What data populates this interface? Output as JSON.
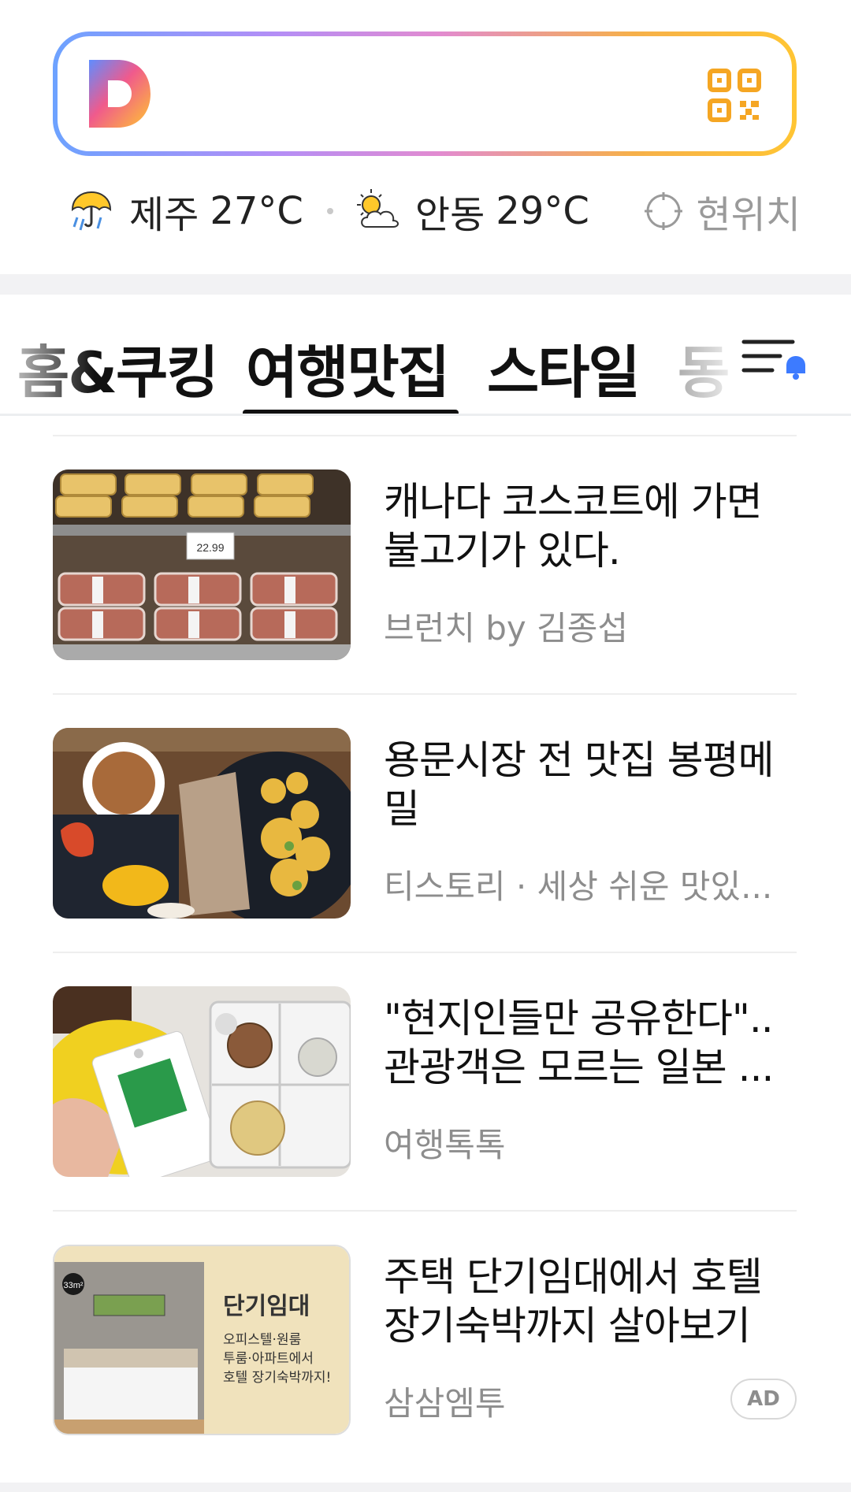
{
  "weather": [
    {
      "city": "제주",
      "temp": "27°C",
      "icon": "rain-umbrella-icon"
    },
    {
      "city": "안동",
      "temp": "29°C",
      "icon": "sun-cloud-icon"
    }
  ],
  "location_label": "현위치",
  "tabs": [
    {
      "label": "홈&쿠킹"
    },
    {
      "label": "여행맛집",
      "active": true
    },
    {
      "label": "스타일"
    },
    {
      "label": "동"
    }
  ],
  "feed": [
    {
      "title": "캐나다 코스코트에 가면 불고기가 있다.",
      "source": "브런치 by 김종섭",
      "ad": false
    },
    {
      "title": "용문시장 전 맛집 봉평메밀",
      "source": "티스토리 · 세상 쉬운 맛있...",
      "ad": false
    },
    {
      "title": "\"현지인들만 공유한다\"..관광객은 모르는 일본 ...",
      "source": "여행톡톡",
      "ad": false
    },
    {
      "title": "주택 단기임대에서 호텔 장기숙박까지 살아보기",
      "source": "삼삼엠투",
      "ad": true,
      "ad_label": "AD"
    }
  ],
  "ad_image": {
    "heading": "단기임대",
    "lines": [
      "오피스텔·원룸",
      "투룸·아파트에서",
      "호텔 장기숙박까지!"
    ],
    "logo": "33m²"
  },
  "price_tag": "22.99",
  "colors": {
    "search_gradient": [
      "#6da2ff",
      "#b48ef6",
      "#e28bd0",
      "#f6b04a",
      "#ffc533"
    ],
    "qr": "#f5a623",
    "bell": "#3d7bff"
  }
}
